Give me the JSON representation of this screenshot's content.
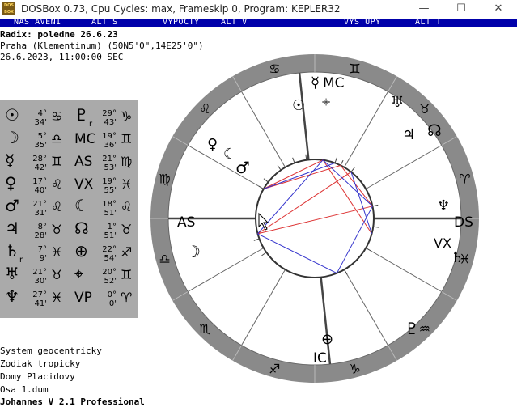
{
  "window": {
    "title": "DOSBox 0.73, Cpu Cycles:      max, Frameskip  0, Program: KEPLER32",
    "icon_label": "DOS BOX",
    "minimize_glyph": "—",
    "maximize_glyph": "☐",
    "close_glyph": "✕"
  },
  "menu": {
    "nastaveni": "NASTAVENI",
    "alt_s": "ALT S",
    "vypocty": "VYPOCTY",
    "alt_v": "ALT V",
    "vystupy": "VYSTUPY",
    "alt_t": "ALT T"
  },
  "header": {
    "radix": "Radix: poledne 26.6.23",
    "place": "Praha (Klementinum) (50N5'0\",14E25'0\")",
    "datetime": "26.6.2023, 11:00:00 SEC"
  },
  "footer": {
    "system": "System geocentricky",
    "zodiac": "Zodiak tropicky",
    "houses": "Domy Placidovy",
    "axis": "Osa 1.dum",
    "program": "Johannes V 2.1 Professional"
  },
  "positions": {
    "left": [
      {
        "glyph": "☉",
        "deg": "4°",
        "min": "34'",
        "sign": "♋"
      },
      {
        "glyph": "☽",
        "deg": "5°",
        "min": "35'",
        "sign": "♎"
      },
      {
        "glyph": "☿",
        "deg": "28°",
        "min": "42'",
        "sign": "♊"
      },
      {
        "glyph": "♀",
        "deg": "17°",
        "min": "40'",
        "sign": "♌"
      },
      {
        "glyph": "♂",
        "deg": "21°",
        "min": "31'",
        "sign": "♌"
      },
      {
        "glyph": "♃",
        "deg": "8°",
        "min": "28'",
        "sign": "♉"
      },
      {
        "glyph": "♄",
        "sub": "r",
        "deg": "7°",
        "min": "9'",
        "sign": "♓"
      },
      {
        "glyph": "♅",
        "deg": "21°",
        "min": "30'",
        "sign": "♉"
      },
      {
        "glyph": "♆",
        "deg": "27°",
        "min": "41'",
        "sign": "♓"
      }
    ],
    "right": [
      {
        "glyph": "♇",
        "sub": "r",
        "deg": "29°",
        "min": "43'",
        "sign": "♑"
      },
      {
        "glyph": "MC",
        "deg": "19°",
        "min": "36'",
        "sign": "♊"
      },
      {
        "glyph": "AS",
        "deg": "21°",
        "min": "53'",
        "sign": "♍"
      },
      {
        "glyph": "VX",
        "deg": "19°",
        "min": "55'",
        "sign": "♓"
      },
      {
        "glyph": "☾",
        "deg": "18°",
        "min": "51'",
        "sign": "♌"
      },
      {
        "glyph": "☊",
        "deg": "1°",
        "min": "51'",
        "sign": "♉"
      },
      {
        "glyph": "⊕",
        "deg": "22°",
        "min": "54'",
        "sign": "♐"
      },
      {
        "glyph": "⌖",
        "deg": "20°",
        "min": "52'",
        "sign": "♊"
      },
      {
        "glyph": "VP",
        "deg": "0°",
        "min": "0'",
        "sign": "♈"
      }
    ]
  },
  "wheel": {
    "zodiac_signs": [
      "♋",
      "♊",
      "♉",
      "♈",
      "♓",
      "♒",
      "♑",
      "♐",
      "♏",
      "♎",
      "♍",
      "♌"
    ],
    "labels": {
      "mc": "MC",
      "as": "AS",
      "ds": "DS",
      "ic": "IC",
      "vx": "VX"
    },
    "bodies": {
      "mercury_top": "☿",
      "sun": "☉",
      "earth_top": "⌖",
      "uranus": "♅",
      "jupiter": "♃",
      "node": "☊",
      "venus": "♀",
      "lilith": "☾",
      "mars": "♂",
      "neptune": "♆",
      "saturn": "♄",
      "moon": "☽",
      "pof": "⊕",
      "pluto": "♇"
    }
  },
  "colors": {
    "menu_bg": "#0000aa",
    "table_bg": "#aaaaaa",
    "ring": "#8a8a8a",
    "aspect_red": "#dd3333",
    "aspect_blue": "#3333cc"
  }
}
